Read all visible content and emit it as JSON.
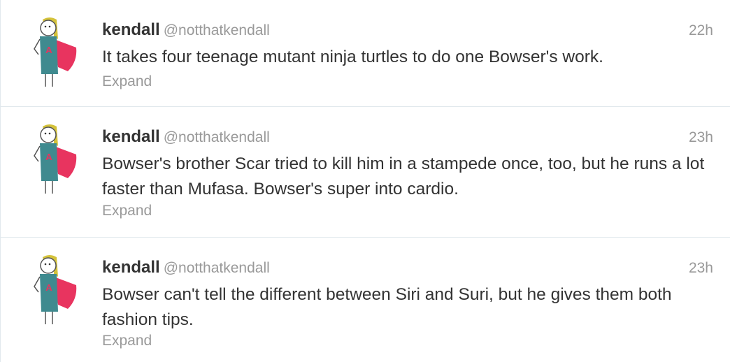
{
  "tweets": [
    {
      "display_name": "kendall",
      "handle": "@notthatkendall",
      "time": "22h",
      "text": "It takes four teenage mutant ninja turtles to do one Bowser's work.",
      "expand_label": "Expand"
    },
    {
      "display_name": "kendall",
      "handle": "@notthatkendall",
      "time": "23h",
      "text": "Bowser's brother Scar tried to kill him in a stampede once, too, but he runs a lot faster than Mufasa. Bowser's super into cardio.",
      "expand_label": "Expand"
    },
    {
      "display_name": "kendall",
      "handle": "@notthatkendall",
      "time": "23h",
      "text": "Bowser can't tell the different between Siri and Suri, but he gives them both fashion tips.",
      "expand_label": "Expand"
    }
  ],
  "avatar": {
    "shirt_letter": "A",
    "colors": {
      "hair": "#d4c23a",
      "shirt": "#3f8a8f",
      "cape": "#e8345f",
      "letter": "#e8345f",
      "outline": "#555555"
    }
  }
}
